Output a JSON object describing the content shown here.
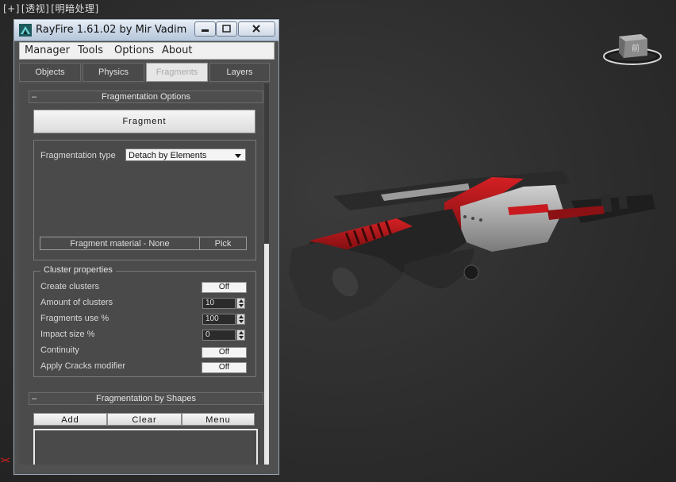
{
  "viewport": {
    "label_parts": [
      "[+]",
      "[透视]",
      "[明暗处理]"
    ]
  },
  "viewcube": {
    "face_label": "前"
  },
  "window": {
    "title": "RayFire 1.61.02  by Mir Vadim",
    "buttons": {
      "minimize": "minimize",
      "maximize": "maximize",
      "close": "close"
    }
  },
  "menu": {
    "items": [
      "Manager",
      "Tools",
      "Options",
      "About"
    ]
  },
  "tabs": [
    {
      "label": "Objects",
      "active": false
    },
    {
      "label": "Physics",
      "active": false
    },
    {
      "label": "Fragments",
      "active": true
    },
    {
      "label": "Layers",
      "active": false
    }
  ],
  "frag_options": {
    "title": "Fragmentation Options",
    "collapse_symbol": "–",
    "fragment_button": "Fragment",
    "type_label": "Fragmentation type",
    "type_value": "Detach by Elements",
    "material_label": "Fragment material - None",
    "pick_label": "Pick"
  },
  "cluster": {
    "title": "Cluster properties",
    "create_label": "Create clusters",
    "create_value": "Off",
    "amount_label": "Amount of clusters",
    "amount_value": "10",
    "fragments_use_label": "Fragments use %",
    "fragments_use_value": "100",
    "impact_label": "Impact size %",
    "impact_value": "0",
    "continuity_label": "Continuity",
    "continuity_value": "Off",
    "cracks_label": "Apply Cracks modifier",
    "cracks_value": "Off"
  },
  "frag_shapes": {
    "title": "Fragmentation by Shapes",
    "collapse_symbol": "–",
    "add_label": "Add",
    "clear_label": "Clear",
    "menu_label": "Menu"
  },
  "colors": {
    "background": "#2e2e2e",
    "panel": "#4b4b4b",
    "accent_red": "#b3161a"
  }
}
